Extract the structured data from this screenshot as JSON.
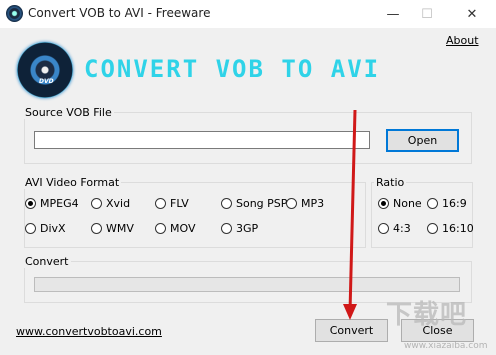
{
  "window": {
    "title": "Convert VOB to AVI - Freeware",
    "minimize_glyph": "—",
    "maximize_glyph": "☐",
    "close_glyph": "✕"
  },
  "about_link": "About",
  "logo": {
    "text": "CONVERT VOB TO AVI",
    "disc_label": "DVD"
  },
  "source": {
    "group_label": "Source VOB File",
    "path_value": "",
    "open_button": "Open"
  },
  "format": {
    "group_label": "AVI Video Format",
    "options": [
      "MPEG4",
      "Xvid",
      "FLV",
      "Song PSP",
      "MP3",
      "DivX",
      "WMV",
      "MOV",
      "3GP"
    ],
    "selected": "MPEG4"
  },
  "ratio": {
    "group_label": "Ratio",
    "options": [
      "None",
      "16:9",
      "4:3",
      "16:10"
    ],
    "selected": "None"
  },
  "convert_group": {
    "label": "Convert",
    "progress": 0
  },
  "website_link": "www.convertvobtoavi.com",
  "buttons": {
    "convert": "Convert",
    "close": "Close"
  },
  "watermark": {
    "text": "下载吧",
    "url": "www.xiazaiba.com"
  },
  "colors": {
    "logo_cyan": "#2fd3e8",
    "accent_blue": "#0078d7",
    "arrow_red": "#d01818"
  }
}
